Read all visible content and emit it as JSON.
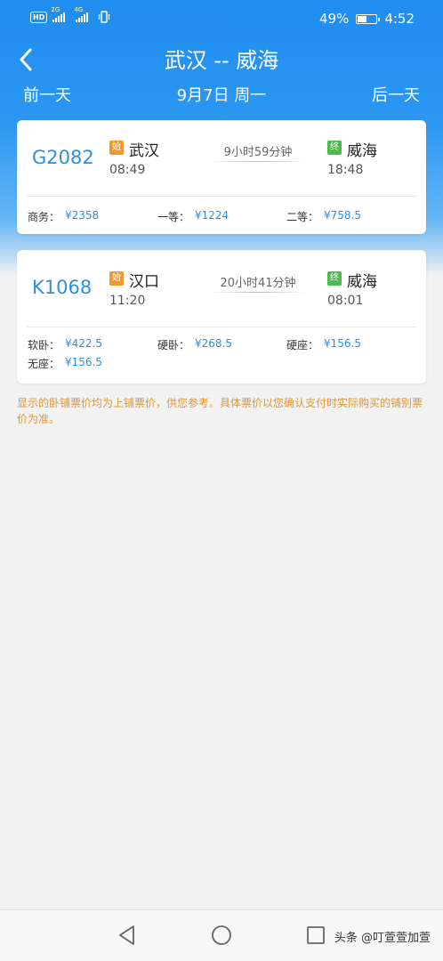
{
  "status_bar": {
    "hd": "HD",
    "net1": "2G",
    "net2": "4G",
    "battery": "49%",
    "time": "4:52"
  },
  "header": {
    "title": "武汉 -- 威海",
    "prev_day": "前一天",
    "date": "9月7日 周一",
    "next_day": "后一天",
    "bg_color": "#2c98f2"
  },
  "trains": [
    {
      "number": "G2082",
      "from_tag": "始",
      "from": "武汉",
      "depart": "08:49",
      "duration": "9小时59分钟",
      "to_tag": "终",
      "to": "威海",
      "arrive": "18:48",
      "seats": [
        {
          "label": "商务：",
          "price": "¥2358"
        },
        {
          "label": "一等：",
          "price": "¥1224"
        },
        {
          "label": "二等：",
          "price": "¥758.5"
        }
      ]
    },
    {
      "number": "K1068",
      "from_tag": "始",
      "from": "汉口",
      "depart": "11:20",
      "duration": "20小时41分钟",
      "to_tag": "终",
      "to": "威海",
      "arrive": "08:01",
      "seats": [
        {
          "label": "软卧：",
          "price": "¥422.5"
        },
        {
          "label": "硬卧：",
          "price": "¥268.5"
        },
        {
          "label": "硬座：",
          "price": "¥156.5"
        },
        {
          "label": "无座：",
          "price": "¥156.5"
        }
      ]
    }
  ],
  "notice": "显示的卧铺票价均为上铺票价，供您参考。具体票价以您确认支付时实际购买的铺别票价为准。",
  "watermark": "头条 @叮萱萱加萱",
  "colors": {
    "accent": "#2f8fd8",
    "start_tag": "#f19a2b",
    "end_tag": "#4dba4d",
    "notice": "#e3972f"
  }
}
